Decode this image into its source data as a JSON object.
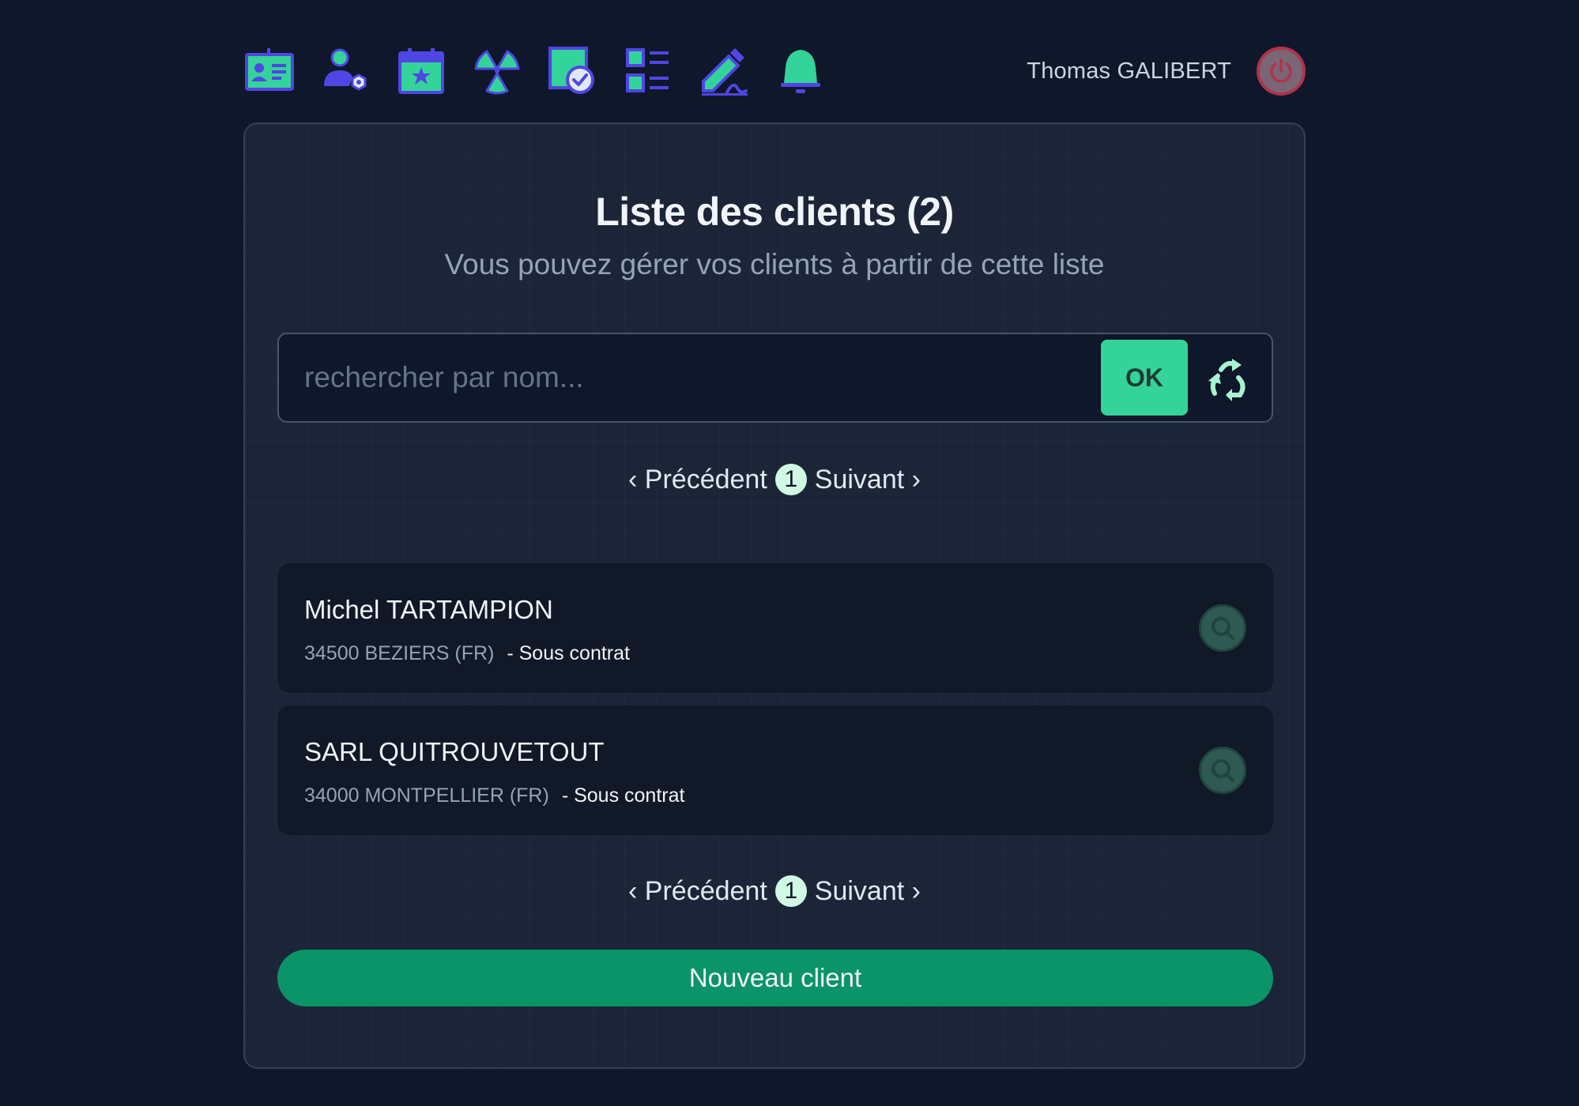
{
  "nav": {
    "icons": [
      {
        "name": "id-card-icon"
      },
      {
        "name": "user-settings-icon"
      },
      {
        "name": "calendar-star-icon"
      },
      {
        "name": "radiation-icon"
      },
      {
        "name": "document-check-icon"
      },
      {
        "name": "list-icon"
      },
      {
        "name": "edit-signature-icon"
      },
      {
        "name": "bell-icon"
      }
    ]
  },
  "user": {
    "name": "Thomas GALIBERT",
    "logout_icon": "power-icon"
  },
  "page": {
    "title": "Liste des clients (2)",
    "subtitle": "Vous pouvez gérer vos clients à partir de cette liste"
  },
  "search": {
    "placeholder": "rechercher par nom...",
    "value": "",
    "ok_label": "OK",
    "reset_icon": "recycle-icon"
  },
  "pagination": {
    "previous_label": "‹ Précédent",
    "current_page": "1",
    "next_label": "Suivant ›"
  },
  "clients": [
    {
      "name": "Michel TARTAMPION",
      "location": "34500 BEZIERS (FR)",
      "status": "- Sous contrat"
    },
    {
      "name": "SARL QUITROUVETOUT",
      "location": "34000 MONTPELLIER (FR)",
      "status": "- Sous contrat"
    }
  ],
  "actions": {
    "new_client_label": "Nouveau client"
  },
  "colors": {
    "background": "#0f172a",
    "card": "#1c2538",
    "accent": "#34d399",
    "primary_button": "#0b9467",
    "icon_blue": "#4f46e5",
    "icon_green": "#34d399",
    "logout_border": "#b0334c"
  }
}
